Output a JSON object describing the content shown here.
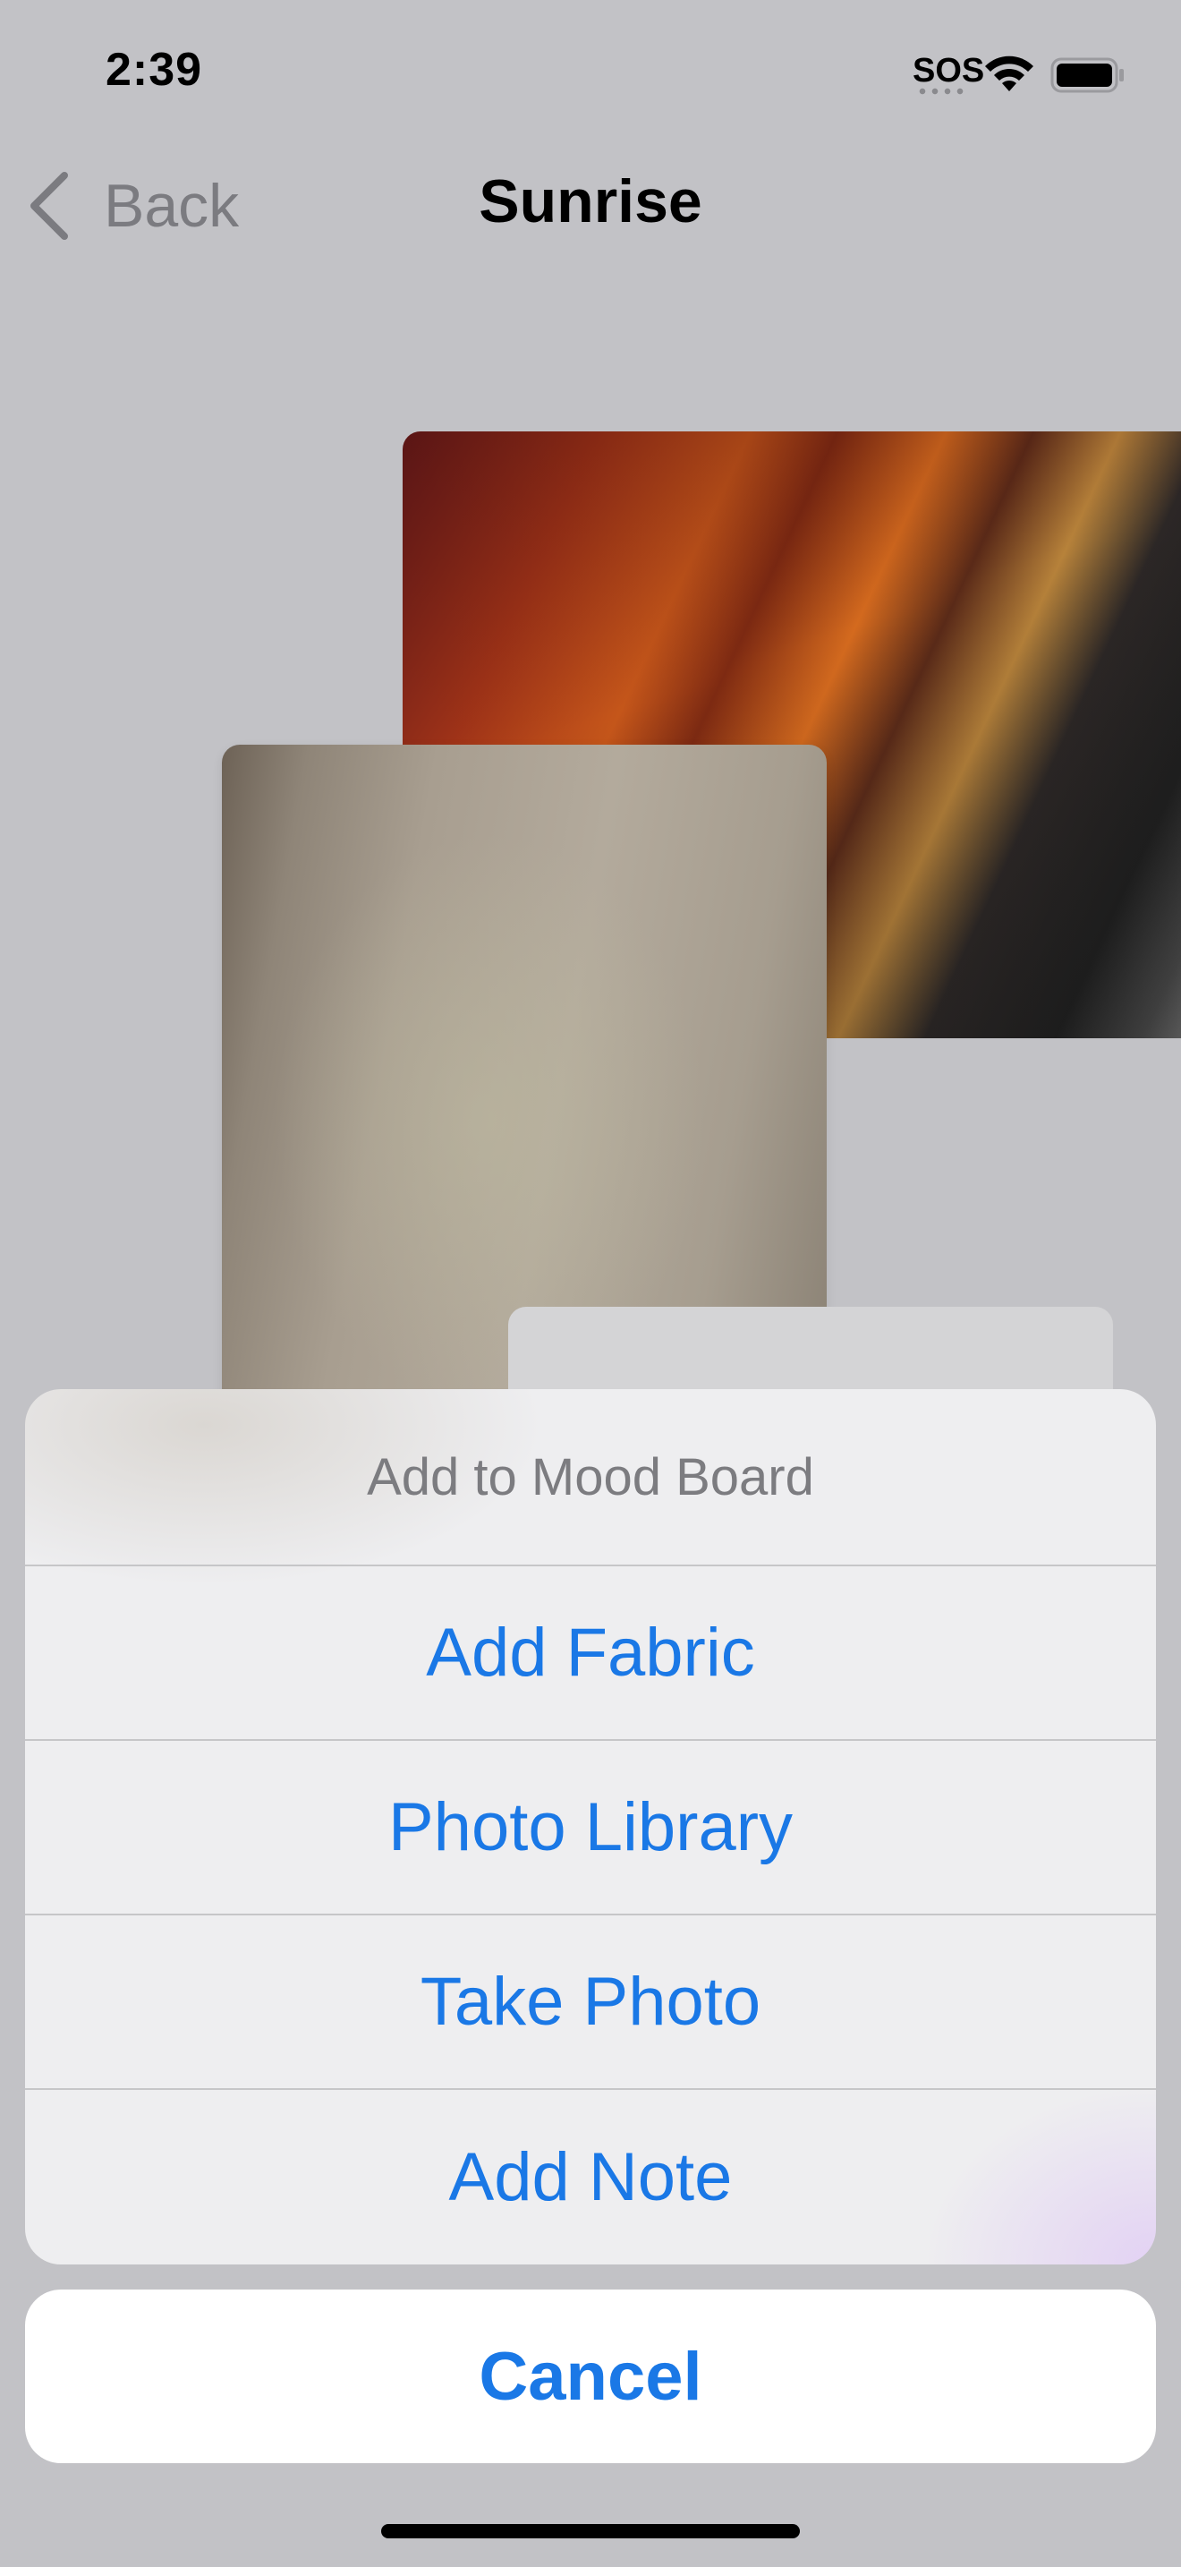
{
  "status_bar": {
    "time": "2:39",
    "carrier": "SOS",
    "icons": [
      "wifi-icon",
      "battery-icon"
    ]
  },
  "nav": {
    "back_label": "Back",
    "title": "Sunrise",
    "back_icon": "chevron-left-icon"
  },
  "mood_board": {
    "items": [
      "fabric-image-red",
      "fabric-image-beige",
      "note-card"
    ]
  },
  "action_sheet": {
    "title": "Add to Mood Board",
    "options": [
      {
        "label": "Add Fabric"
      },
      {
        "label": "Photo Library"
      },
      {
        "label": "Take Photo"
      },
      {
        "label": "Add Note"
      }
    ],
    "cancel_label": "Cancel"
  },
  "colors": {
    "accent": "#1a78e6",
    "background": "#c2c2c6",
    "sheet_background": "#eeeef0"
  }
}
